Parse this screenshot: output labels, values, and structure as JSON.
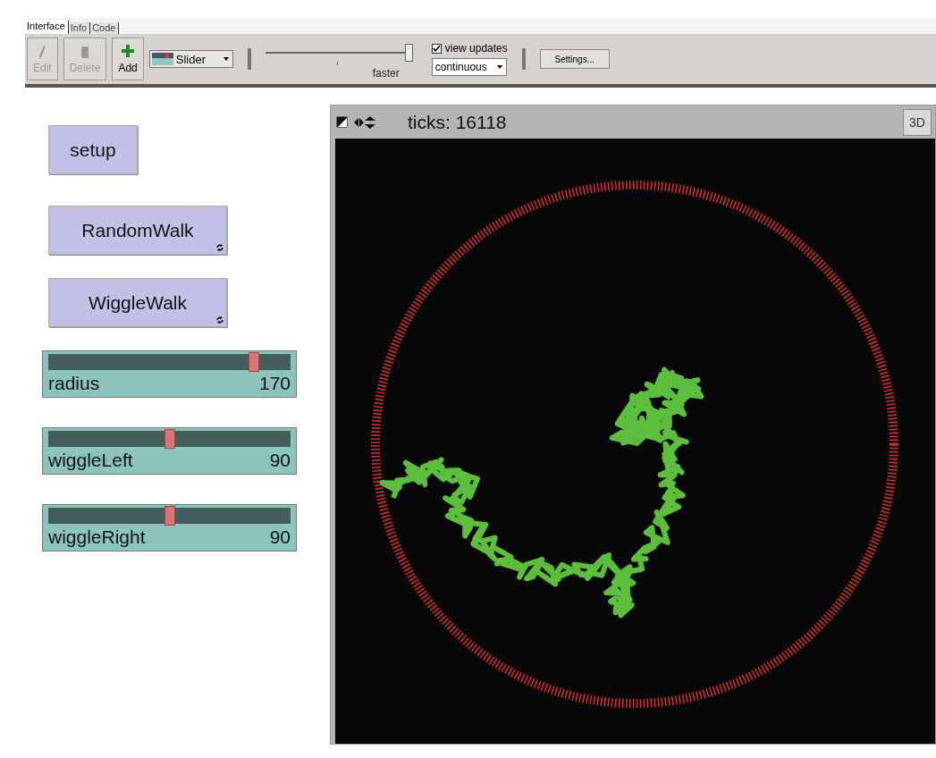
{
  "tabs": [
    {
      "label": "Interface",
      "selected": true
    },
    {
      "label": "Info",
      "selected": false
    },
    {
      "label": "Code",
      "selected": false
    }
  ],
  "toolbar": {
    "buttons": [
      {
        "kind": "edit",
        "label": "Edit",
        "disabled": true
      },
      {
        "kind": "delete",
        "label": "Delete",
        "disabled": true
      },
      {
        "kind": "add",
        "label": "Add",
        "disabled": false
      }
    ],
    "widget_type": "Slider",
    "speed": {
      "level": 0.97,
      "label": "faster"
    },
    "view_updates": {
      "label": "view updates",
      "checked": true
    },
    "update_mode": "continuous",
    "settings": "Settings..."
  },
  "widgets": [
    {
      "kind": "button",
      "label": "setup",
      "forever": false
    },
    {
      "kind": "button",
      "label": "RandomWalk",
      "forever": true
    },
    {
      "kind": "button",
      "label": "WiggleWalk",
      "forever": true
    },
    {
      "kind": "slider",
      "label": "radius",
      "value": "170",
      "level": 0.85
    },
    {
      "kind": "slider",
      "label": "wiggleLeft",
      "value": "90",
      "level": 0.5
    },
    {
      "kind": "slider",
      "label": "wiggleRight",
      "value": "90",
      "level": 0.5
    }
  ],
  "view": {
    "ticks": "ticks: 16118",
    "button_3d": "3D"
  }
}
